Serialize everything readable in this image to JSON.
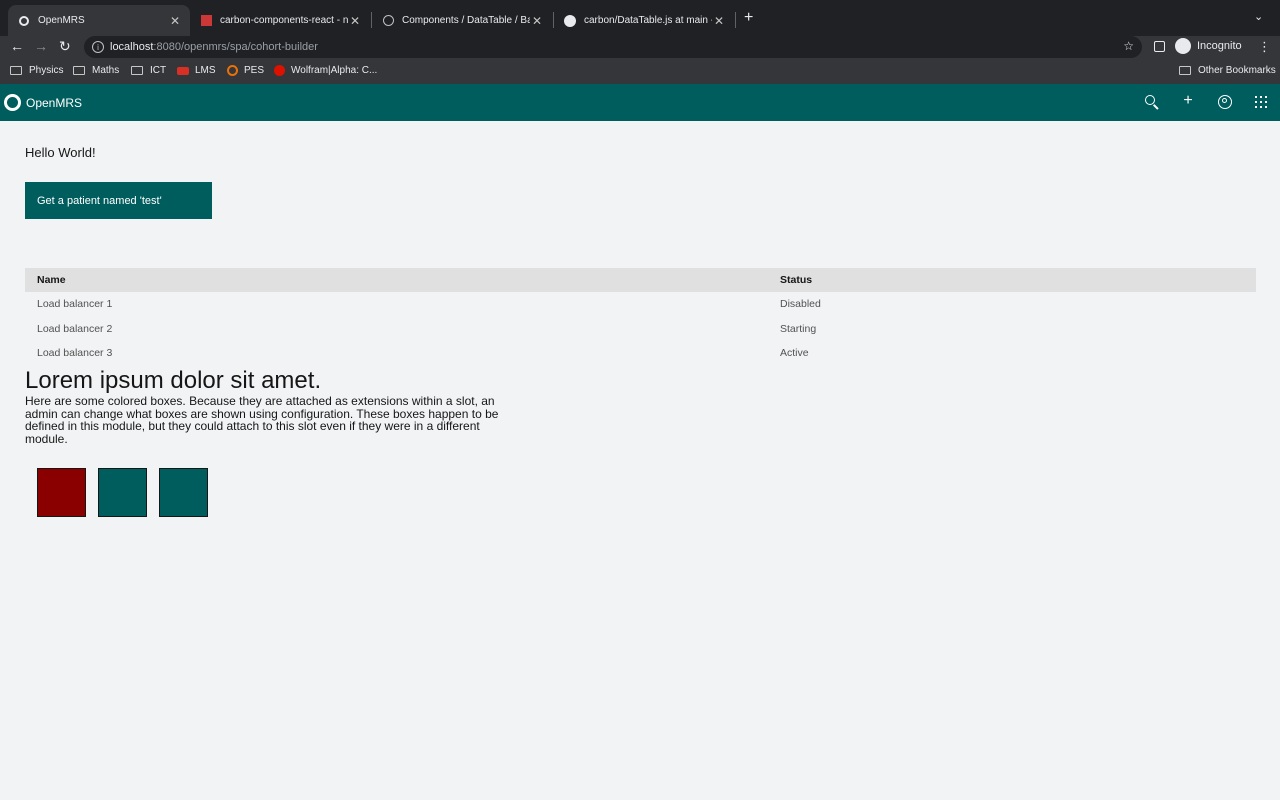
{
  "browser": {
    "tabs": [
      {
        "title": "OpenMRS",
        "icon": "openmrs-favicon-icon",
        "active": true
      },
      {
        "title": "carbon-components-react - npm",
        "icon": "npm-favicon-icon",
        "active": false
      },
      {
        "title": "Components / DataTable / Basic",
        "icon": "globe-favicon-icon",
        "active": false
      },
      {
        "title": "carbon/DataTable.js at main - c",
        "icon": "github-favicon-icon",
        "active": false
      }
    ],
    "url_host": "localhost",
    "url_path": ":8080/openmrs/spa/cohort-builder",
    "profile_label": "Incognito",
    "bookmarks": [
      {
        "label": "Physics",
        "icon": "folder-icon"
      },
      {
        "label": "Maths",
        "icon": "folder-icon"
      },
      {
        "label": "ICT",
        "icon": "folder-icon"
      },
      {
        "label": "LMS",
        "icon": "lms-favicon-icon"
      },
      {
        "label": "PES",
        "icon": "pes-favicon-icon"
      },
      {
        "label": "Wolfram|Alpha: C...",
        "icon": "wolfram-favicon-icon"
      }
    ],
    "other_bookmarks": "Other Bookmarks"
  },
  "app": {
    "name": "OpenMRS",
    "brand_color": "#005d5d"
  },
  "main": {
    "greeting": "Hello World!",
    "action_button": "Get a patient named 'test'",
    "table": {
      "headers": [
        "Name",
        "Status"
      ],
      "rows": [
        [
          "Load balancer 1",
          "Disabled"
        ],
        [
          "Load balancer 2",
          "Starting"
        ],
        [
          "Load balancer 3",
          "Active"
        ]
      ]
    },
    "lorem_title": "Lorem ipsum dolor sit amet.",
    "lorem_text": "Here are some colored boxes. Because they are attached as extensions within a slot, an admin can change what boxes are shown using configuration. These boxes happen to be defined in this module, but they could attach to this slot even if they were in a different module.",
    "boxes": [
      {
        "color": "#8a0000"
      },
      {
        "color": "#005d5d"
      },
      {
        "color": "#005d5d"
      }
    ]
  }
}
